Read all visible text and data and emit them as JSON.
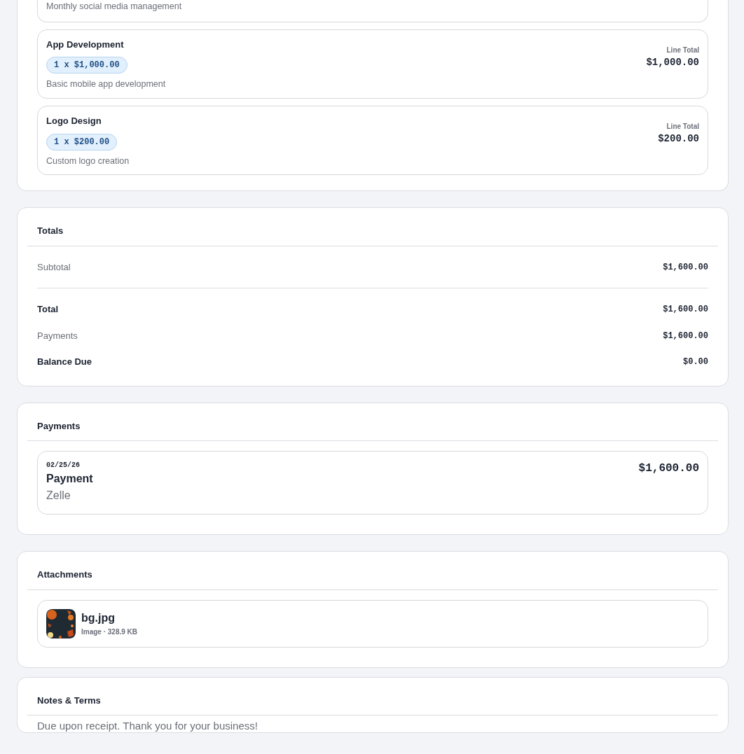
{
  "line_items": [
    {
      "description": "Monthly social media management"
    },
    {
      "name": "App Development",
      "quantity_price": "1 x $1,000.00",
      "description": "Basic mobile app development",
      "total_label": "Line Total",
      "total": "$1,000.00"
    },
    {
      "name": "Logo Design",
      "quantity_price": "1 x $200.00",
      "description": "Custom logo creation",
      "total_label": "Line Total",
      "total": "$200.00"
    }
  ],
  "totals": {
    "title": "Totals",
    "subtotal": {
      "label": "Subtotal",
      "amount": "$1,600.00"
    },
    "rows": [
      {
        "label": "Total",
        "amount": "$1,600.00",
        "bold": true
      },
      {
        "label": "Payments",
        "amount": "$1,600.00",
        "bold": false
      },
      {
        "label": "Balance Due",
        "amount": "$0.00",
        "bold": true
      }
    ]
  },
  "payments": {
    "title": "Payments",
    "items": [
      {
        "date": "02/25/26",
        "title": "Payment",
        "method": "Zelle",
        "amount": "$1,600.00"
      }
    ]
  },
  "attachments": {
    "title": "Attachments",
    "items": [
      {
        "name": "bg.jpg",
        "meta": "Image · 328.9 KB"
      }
    ]
  },
  "notes": {
    "title": "Notes & Terms",
    "text": "Due upon receipt. Thank you for your business!"
  }
}
